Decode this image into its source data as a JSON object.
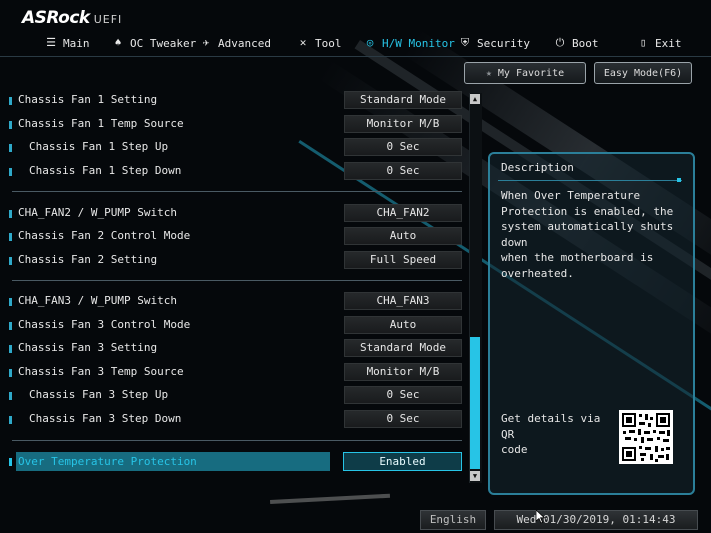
{
  "app": {
    "logo": "ASRock",
    "logo_suffix": "UEFI"
  },
  "nav": {
    "items": [
      {
        "label": "Main",
        "icon": "list-icon"
      },
      {
        "label": "OC Tweaker",
        "icon": "rocket-icon"
      },
      {
        "label": "Advanced",
        "icon": "plane-icon"
      },
      {
        "label": "Tool",
        "icon": "tools-icon"
      },
      {
        "label": "H/W Monitor",
        "icon": "monitor-icon",
        "active": true
      },
      {
        "label": "Security",
        "icon": "shield-icon"
      },
      {
        "label": "Boot",
        "icon": "power-icon"
      },
      {
        "label": "Exit",
        "icon": "exit-door-icon"
      }
    ],
    "active_color": "#27c4e6"
  },
  "top_buttons": {
    "favorite": "My Favorite",
    "easy_mode": "Easy Mode(F6)"
  },
  "settings": [
    {
      "label": "Chassis Fan 1 Setting",
      "value": "Standard Mode",
      "sub": false
    },
    {
      "label": "Chassis Fan 1 Temp Source",
      "value": "Monitor M/B",
      "sub": false
    },
    {
      "label": "Chassis Fan 1 Step Up",
      "value": "0 Sec",
      "sub": true
    },
    {
      "label": "Chassis Fan 1 Step Down",
      "value": "0 Sec",
      "sub": true
    },
    {
      "label": "CHA_FAN2 / W_PUMP Switch",
      "value": "CHA_FAN2",
      "sub": false
    },
    {
      "label": "Chassis Fan 2 Control Mode",
      "value": "Auto",
      "sub": false
    },
    {
      "label": "Chassis Fan 2 Setting",
      "value": "Full Speed",
      "sub": false
    },
    {
      "label": "CHA_FAN3 / W_PUMP Switch",
      "value": "CHA_FAN3",
      "sub": false
    },
    {
      "label": "Chassis Fan 3 Control Mode",
      "value": "Auto",
      "sub": false
    },
    {
      "label": "Chassis Fan 3 Setting",
      "value": "Standard Mode",
      "sub": false
    },
    {
      "label": "Chassis Fan 3 Temp Source",
      "value": "Monitor M/B",
      "sub": false
    },
    {
      "label": "Chassis Fan 3 Step Up",
      "value": "0 Sec",
      "sub": true
    },
    {
      "label": "Chassis Fan 3 Step Down",
      "value": "0 Sec",
      "sub": true
    }
  ],
  "selected_setting": {
    "label": "Over Temperature Protection",
    "value": "Enabled"
  },
  "description": {
    "title": "Description",
    "text": "When Over Temperature\nProtection is enabled, the\nsystem automatically shuts down\nwhen the motherboard is\noverheated.",
    "qr_text": "Get details via QR\ncode"
  },
  "bottom": {
    "language": "English",
    "datetime": "Wed 01/30/2019, 01:14:43"
  }
}
